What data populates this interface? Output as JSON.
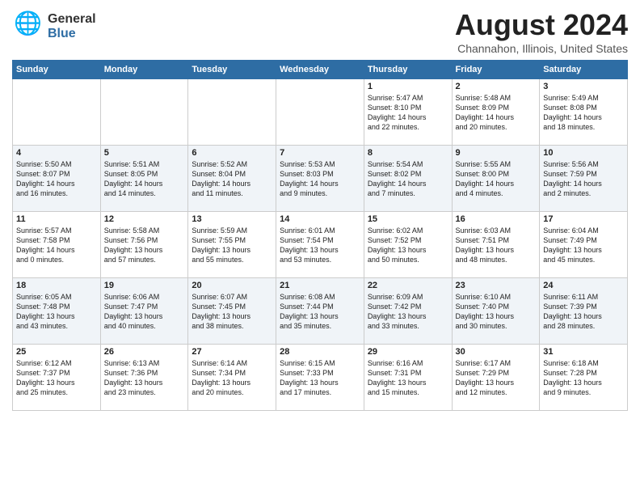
{
  "header": {
    "logo_line1": "General",
    "logo_line2": "Blue",
    "title": "August 2024",
    "subtitle": "Channahon, Illinois, United States"
  },
  "days_of_week": [
    "Sunday",
    "Monday",
    "Tuesday",
    "Wednesday",
    "Thursday",
    "Friday",
    "Saturday"
  ],
  "weeks": [
    [
      {
        "day": "",
        "content": ""
      },
      {
        "day": "",
        "content": ""
      },
      {
        "day": "",
        "content": ""
      },
      {
        "day": "",
        "content": ""
      },
      {
        "day": "1",
        "content": "Sunrise: 5:47 AM\nSunset: 8:10 PM\nDaylight: 14 hours\nand 22 minutes."
      },
      {
        "day": "2",
        "content": "Sunrise: 5:48 AM\nSunset: 8:09 PM\nDaylight: 14 hours\nand 20 minutes."
      },
      {
        "day": "3",
        "content": "Sunrise: 5:49 AM\nSunset: 8:08 PM\nDaylight: 14 hours\nand 18 minutes."
      }
    ],
    [
      {
        "day": "4",
        "content": "Sunrise: 5:50 AM\nSunset: 8:07 PM\nDaylight: 14 hours\nand 16 minutes."
      },
      {
        "day": "5",
        "content": "Sunrise: 5:51 AM\nSunset: 8:05 PM\nDaylight: 14 hours\nand 14 minutes."
      },
      {
        "day": "6",
        "content": "Sunrise: 5:52 AM\nSunset: 8:04 PM\nDaylight: 14 hours\nand 11 minutes."
      },
      {
        "day": "7",
        "content": "Sunrise: 5:53 AM\nSunset: 8:03 PM\nDaylight: 14 hours\nand 9 minutes."
      },
      {
        "day": "8",
        "content": "Sunrise: 5:54 AM\nSunset: 8:02 PM\nDaylight: 14 hours\nand 7 minutes."
      },
      {
        "day": "9",
        "content": "Sunrise: 5:55 AM\nSunset: 8:00 PM\nDaylight: 14 hours\nand 4 minutes."
      },
      {
        "day": "10",
        "content": "Sunrise: 5:56 AM\nSunset: 7:59 PM\nDaylight: 14 hours\nand 2 minutes."
      }
    ],
    [
      {
        "day": "11",
        "content": "Sunrise: 5:57 AM\nSunset: 7:58 PM\nDaylight: 14 hours\nand 0 minutes."
      },
      {
        "day": "12",
        "content": "Sunrise: 5:58 AM\nSunset: 7:56 PM\nDaylight: 13 hours\nand 57 minutes."
      },
      {
        "day": "13",
        "content": "Sunrise: 5:59 AM\nSunset: 7:55 PM\nDaylight: 13 hours\nand 55 minutes."
      },
      {
        "day": "14",
        "content": "Sunrise: 6:01 AM\nSunset: 7:54 PM\nDaylight: 13 hours\nand 53 minutes."
      },
      {
        "day": "15",
        "content": "Sunrise: 6:02 AM\nSunset: 7:52 PM\nDaylight: 13 hours\nand 50 minutes."
      },
      {
        "day": "16",
        "content": "Sunrise: 6:03 AM\nSunset: 7:51 PM\nDaylight: 13 hours\nand 48 minutes."
      },
      {
        "day": "17",
        "content": "Sunrise: 6:04 AM\nSunset: 7:49 PM\nDaylight: 13 hours\nand 45 minutes."
      }
    ],
    [
      {
        "day": "18",
        "content": "Sunrise: 6:05 AM\nSunset: 7:48 PM\nDaylight: 13 hours\nand 43 minutes."
      },
      {
        "day": "19",
        "content": "Sunrise: 6:06 AM\nSunset: 7:47 PM\nDaylight: 13 hours\nand 40 minutes."
      },
      {
        "day": "20",
        "content": "Sunrise: 6:07 AM\nSunset: 7:45 PM\nDaylight: 13 hours\nand 38 minutes."
      },
      {
        "day": "21",
        "content": "Sunrise: 6:08 AM\nSunset: 7:44 PM\nDaylight: 13 hours\nand 35 minutes."
      },
      {
        "day": "22",
        "content": "Sunrise: 6:09 AM\nSunset: 7:42 PM\nDaylight: 13 hours\nand 33 minutes."
      },
      {
        "day": "23",
        "content": "Sunrise: 6:10 AM\nSunset: 7:40 PM\nDaylight: 13 hours\nand 30 minutes."
      },
      {
        "day": "24",
        "content": "Sunrise: 6:11 AM\nSunset: 7:39 PM\nDaylight: 13 hours\nand 28 minutes."
      }
    ],
    [
      {
        "day": "25",
        "content": "Sunrise: 6:12 AM\nSunset: 7:37 PM\nDaylight: 13 hours\nand 25 minutes."
      },
      {
        "day": "26",
        "content": "Sunrise: 6:13 AM\nSunset: 7:36 PM\nDaylight: 13 hours\nand 23 minutes."
      },
      {
        "day": "27",
        "content": "Sunrise: 6:14 AM\nSunset: 7:34 PM\nDaylight: 13 hours\nand 20 minutes."
      },
      {
        "day": "28",
        "content": "Sunrise: 6:15 AM\nSunset: 7:33 PM\nDaylight: 13 hours\nand 17 minutes."
      },
      {
        "day": "29",
        "content": "Sunrise: 6:16 AM\nSunset: 7:31 PM\nDaylight: 13 hours\nand 15 minutes."
      },
      {
        "day": "30",
        "content": "Sunrise: 6:17 AM\nSunset: 7:29 PM\nDaylight: 13 hours\nand 12 minutes."
      },
      {
        "day": "31",
        "content": "Sunrise: 6:18 AM\nSunset: 7:28 PM\nDaylight: 13 hours\nand 9 minutes."
      }
    ]
  ]
}
